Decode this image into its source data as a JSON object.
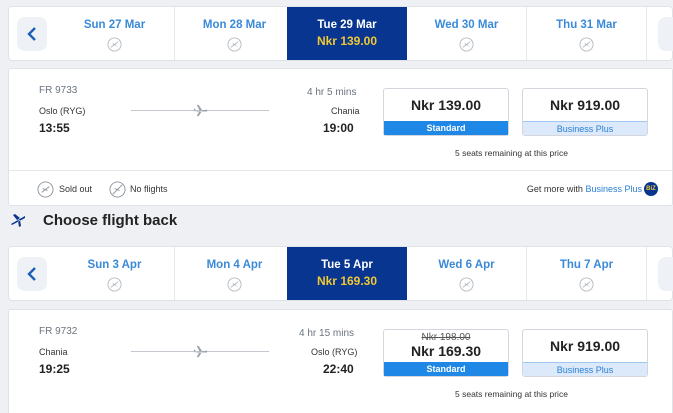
{
  "outbound": {
    "dates": [
      {
        "label": "Sun 27 Mar",
        "price": "",
        "selected": false
      },
      {
        "label": "Mon 28 Mar",
        "price": "",
        "selected": false
      },
      {
        "label": "Tue 29 Mar",
        "price": "Nkr 139.00",
        "selected": true
      },
      {
        "label": "Wed 30 Mar",
        "price": "",
        "selected": false
      },
      {
        "label": "Thu 31 Mar",
        "price": "",
        "selected": false
      }
    ],
    "flight": {
      "number": "FR 9733",
      "duration": "4 hr 5 mins",
      "from_city": "Oslo (RYG)",
      "depart_time": "13:55",
      "to_city": "Chania",
      "arrive_time": "19:00",
      "standard_price": "Nkr 139.00",
      "standard_label": "Standard",
      "business_price": "Nkr 919.00",
      "business_label": "Business Plus",
      "seats_note": "5 seats remaining at this price"
    },
    "legend": {
      "sold_out": "Sold out",
      "no_flights": "No flights",
      "more_prefix": "Get more with",
      "more_link": "Business Plus",
      "badge": "BiZ"
    }
  },
  "return_section": {
    "title": "Choose flight back"
  },
  "inbound": {
    "dates": [
      {
        "label": "Sun 3 Apr",
        "price": "",
        "selected": false
      },
      {
        "label": "Mon 4 Apr",
        "price": "",
        "selected": false
      },
      {
        "label": "Tue 5 Apr",
        "price": "Nkr 169.30",
        "selected": true
      },
      {
        "label": "Wed 6 Apr",
        "price": "",
        "selected": false
      },
      {
        "label": "Thu 7 Apr",
        "price": "",
        "selected": false
      }
    ],
    "flight": {
      "number": "FR 9732",
      "duration": "4 hr 15 mins",
      "from_city": "Chania",
      "depart_time": "19:25",
      "to_city": "Oslo (RYG)",
      "arrive_time": "22:40",
      "standard_old_price": "Nkr 198.00",
      "standard_price": "Nkr 169.30",
      "standard_label": "Standard",
      "business_price": "Nkr 919.00",
      "business_label": "Business Plus",
      "seats_note": "5 seats remaining at this price"
    }
  },
  "colors": {
    "selected_day": "#073590",
    "price_accent": "#f1c933",
    "standard_tag": "#1f87e5",
    "link_blue": "#2a7fd4"
  },
  "icons": [
    "chevron-left-icon",
    "unavailable-icon",
    "plane-icon",
    "sold-out-icon",
    "no-flights-icon",
    "business-plus-badge",
    "takeoff-plane-icon"
  ]
}
